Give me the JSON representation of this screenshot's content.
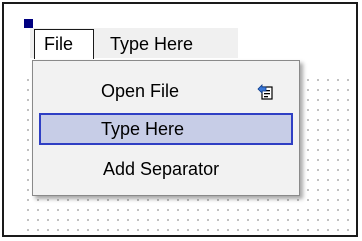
{
  "menubar": {
    "items": [
      {
        "label": "File"
      },
      {
        "label": "Type Here"
      }
    ]
  },
  "dropdown": {
    "items": [
      {
        "label": "Open File",
        "icon": "open-file-icon"
      },
      {
        "label": "Type Here"
      },
      {
        "label": "Add Separator"
      }
    ]
  },
  "colors": {
    "highlight_fill": "#c7cde7",
    "highlight_border": "#2f3fc4",
    "selection_handle": "#000080"
  }
}
